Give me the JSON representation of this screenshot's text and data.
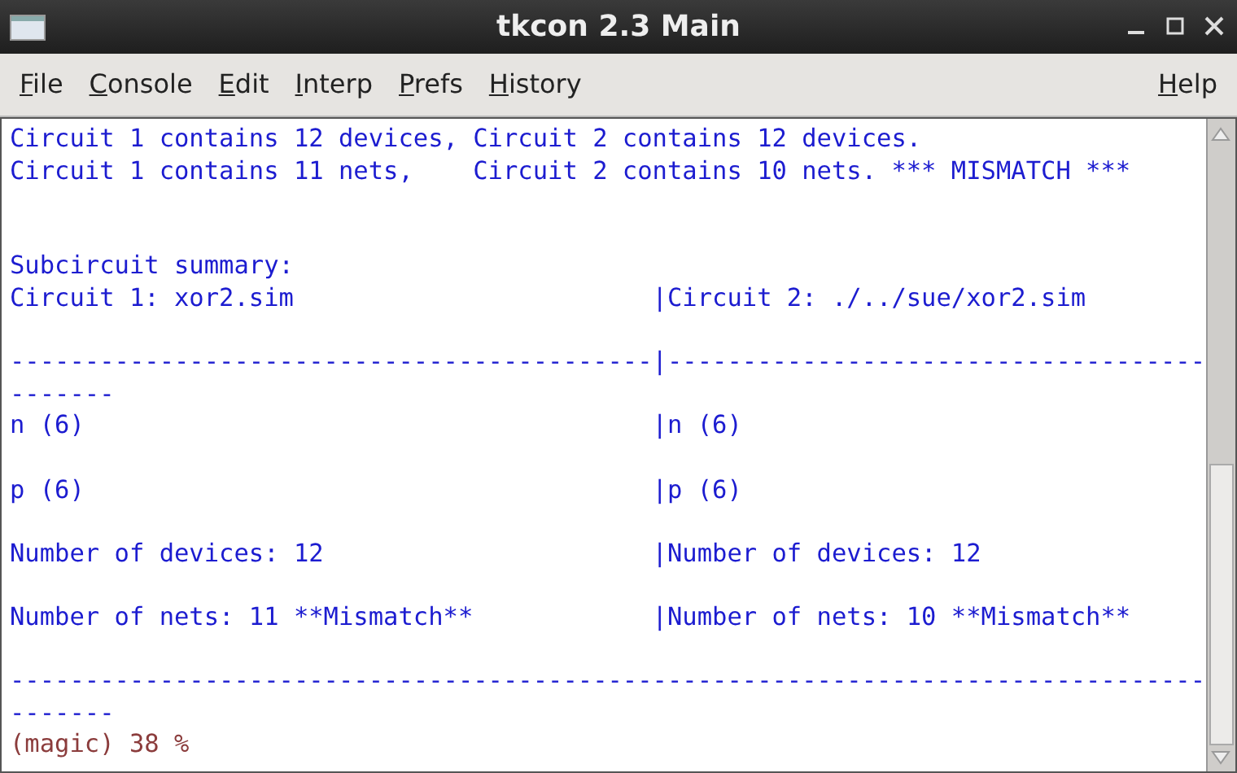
{
  "window": {
    "title": "tkcon 2.3 Main"
  },
  "menu": [
    {
      "label": "File"
    },
    {
      "label": "Console"
    },
    {
      "label": "Edit"
    },
    {
      "label": "Interp"
    },
    {
      "label": "Prefs"
    },
    {
      "label": "History"
    }
  ],
  "menu_right": [
    {
      "label": "Help"
    }
  ],
  "console": [
    {
      "kind": "output",
      "text": "Circuit 1 contains 12 devices, Circuit 2 contains 12 devices."
    },
    {
      "kind": "output",
      "text": "Circuit 1 contains 11 nets,    Circuit 2 contains 10 nets. *** MISMATCH ***"
    },
    {
      "kind": "blank"
    },
    {
      "kind": "blank"
    },
    {
      "kind": "output",
      "text": "Subcircuit summary:"
    },
    {
      "kind": "output",
      "text": "Circuit 1: xor2.sim                        |Circuit 2: ./../sue/xor2.sim"
    },
    {
      "kind": "blank"
    },
    {
      "kind": "output",
      "text": "-------------------------------------------|------------------------------------"
    },
    {
      "kind": "output",
      "text": "-------"
    },
    {
      "kind": "output",
      "text": "n (6)                                      |n (6)"
    },
    {
      "kind": "blank"
    },
    {
      "kind": "output",
      "text": "p (6)                                      |p (6)"
    },
    {
      "kind": "blank"
    },
    {
      "kind": "output",
      "text": "Number of devices: 12                      |Number of devices: 12"
    },
    {
      "kind": "blank"
    },
    {
      "kind": "output",
      "text": "Number of nets: 11 **Mismatch**            |Number of nets: 10 **Mismatch**"
    },
    {
      "kind": "blank"
    },
    {
      "kind": "output",
      "text": "--------------------------------------------------------------------------------"
    },
    {
      "kind": "output",
      "text": "-------"
    },
    {
      "kind": "prompt",
      "text": "(magic) 38 %"
    }
  ]
}
